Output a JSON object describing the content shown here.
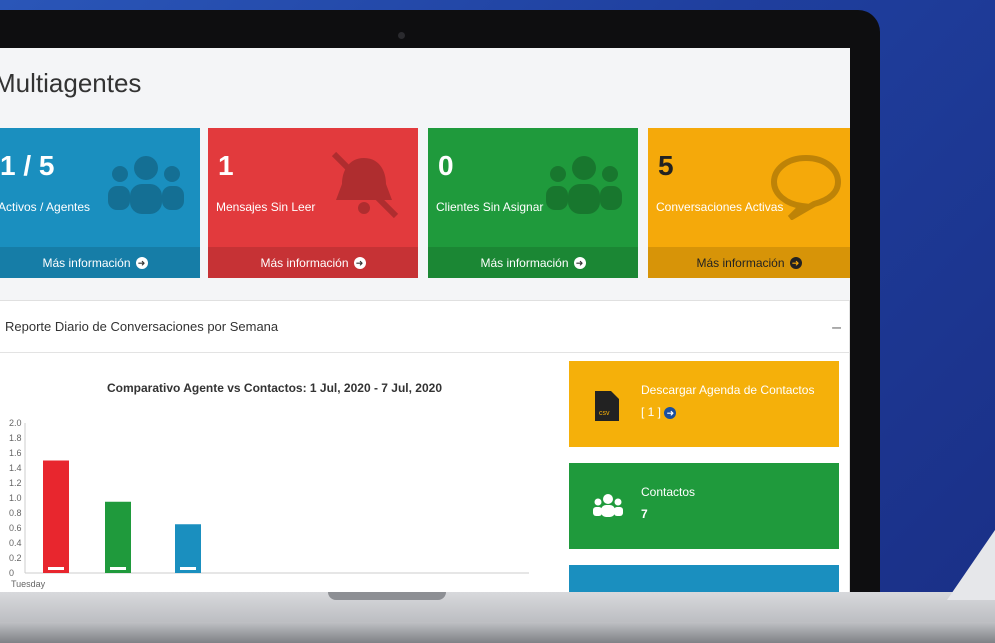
{
  "page": {
    "title": "Multiagentes"
  },
  "cards": [
    {
      "value": "1 / 5",
      "label": "Activos / Agentes",
      "footer": "Más información",
      "color": "#1a8fbf",
      "icon": "users-icon"
    },
    {
      "value": "1",
      "label": "Mensajes Sin Leer",
      "footer": "Más información",
      "color": "#e23a3d",
      "icon": "bell-slash-icon"
    },
    {
      "value": "0",
      "label": "Clientes Sin Asignar",
      "footer": "Más información",
      "color": "#1f9a3c",
      "icon": "users-icon"
    },
    {
      "value": "5",
      "label": "Conversaciones Activas",
      "footer": "Más información",
      "color": "#f5a90a",
      "icon": "chat-bubble-icon"
    }
  ],
  "report": {
    "title": "Reporte Diario de Conversaciones por Semana",
    "collapse_label": "–"
  },
  "chart_data": {
    "type": "bar",
    "title": "Comparativo Agente vs Contactos: 1 Jul, 2020 - 7 Jul, 2020",
    "categories": [
      "Tuesday"
    ],
    "series": [
      {
        "values": [
          1.5
        ],
        "color": "#e8262e"
      },
      {
        "values": [
          0.95
        ],
        "color": "#1f9a3c"
      },
      {
        "values": [
          0.65
        ],
        "color": "#1a8fbf"
      }
    ],
    "ylim": [
      0,
      2.0
    ],
    "yticks": [
      "2.0",
      "1.8",
      "1.6",
      "1.4",
      "1.2",
      "1.0",
      "0.8",
      "0.6",
      "0.4",
      "0.2",
      "0"
    ],
    "xlabel": "",
    "ylabel": ""
  },
  "side_boxes": [
    {
      "text": "Descargar Agenda de Contactos",
      "sub": "[ 1 ]",
      "color": "#f5b00a",
      "icon": "csv-file-icon"
    },
    {
      "text": "Contactos",
      "sub": "7",
      "color": "#1f9a3c",
      "icon": "users-icon"
    },
    {
      "text": "",
      "sub": "",
      "color": "#1a8fbf",
      "icon": ""
    }
  ]
}
